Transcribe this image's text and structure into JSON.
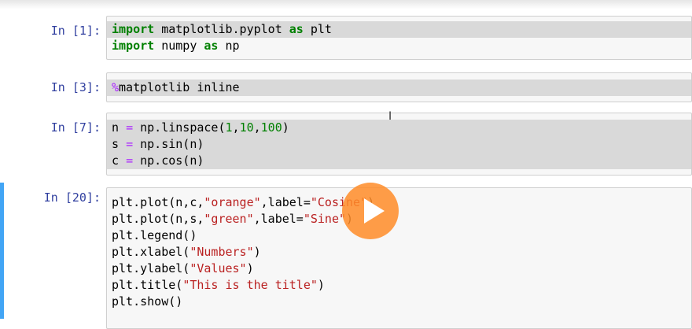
{
  "cells": [
    {
      "prompt": "In [1]:",
      "lines": [
        [
          {
            "t": "import",
            "c": "kw"
          },
          {
            "t": " matplotlib.pyplot ",
            "c": ""
          },
          {
            "t": "as",
            "c": "kw"
          },
          {
            "t": " plt",
            "c": ""
          }
        ],
        [
          {
            "t": "import",
            "c": "kw"
          },
          {
            "t": " numpy ",
            "c": ""
          },
          {
            "t": "as",
            "c": "kw"
          },
          {
            "t": " np",
            "c": ""
          }
        ]
      ]
    },
    {
      "prompt": "In [3]:",
      "lines": [
        [
          {
            "t": "%",
            "c": "magic"
          },
          {
            "t": "matplotlib inline",
            "c": ""
          }
        ]
      ]
    },
    {
      "prompt": "In [7]:",
      "lines": [
        [
          {
            "t": "n ",
            "c": ""
          },
          {
            "t": "=",
            "c": "eq"
          },
          {
            "t": " np.linspace(",
            "c": ""
          },
          {
            "t": "1",
            "c": "num"
          },
          {
            "t": ",",
            "c": ""
          },
          {
            "t": "10",
            "c": "num"
          },
          {
            "t": ",",
            "c": ""
          },
          {
            "t": "100",
            "c": "num"
          },
          {
            "t": ")",
            "c": ""
          }
        ],
        [
          {
            "t": "s ",
            "c": ""
          },
          {
            "t": "=",
            "c": "eq"
          },
          {
            "t": " np.sin(n)",
            "c": ""
          }
        ],
        [
          {
            "t": "c ",
            "c": ""
          },
          {
            "t": "=",
            "c": "eq"
          },
          {
            "t": " np.cos(n)",
            "c": ""
          }
        ]
      ]
    },
    {
      "prompt": "In [20]:",
      "lines": [
        [
          {
            "t": "plt.plot(n,c,",
            "c": ""
          },
          {
            "t": "\"orange\"",
            "c": "str"
          },
          {
            "t": ",label=",
            "c": ""
          },
          {
            "t": "\"Cosine\"",
            "c": "str"
          },
          {
            "t": ")",
            "c": ""
          }
        ],
        [
          {
            "t": "plt.plot(n,s,",
            "c": ""
          },
          {
            "t": "\"green\"",
            "c": "str"
          },
          {
            "t": ",label=",
            "c": ""
          },
          {
            "t": "\"Sine\"",
            "c": "str"
          },
          {
            "t": ")",
            "c": ""
          }
        ],
        [
          {
            "t": "plt.legend()",
            "c": ""
          }
        ],
        [
          {
            "t": "plt.xlabel(",
            "c": ""
          },
          {
            "t": "\"Numbers\"",
            "c": "str"
          },
          {
            "t": ")",
            "c": ""
          }
        ],
        [
          {
            "t": "plt.ylabel(",
            "c": ""
          },
          {
            "t": "\"Values\"",
            "c": "str"
          },
          {
            "t": ")",
            "c": ""
          }
        ],
        [
          {
            "t": "plt.title(",
            "c": ""
          },
          {
            "t": "\"This is the title\"",
            "c": "str"
          },
          {
            "t": ")",
            "c": ""
          }
        ],
        [
          {
            "t": "plt.show()",
            "c": ""
          }
        ]
      ]
    }
  ],
  "cursor_glyph": "I",
  "icons": {
    "play": "play-icon",
    "cursor": "text-cursor-icon"
  },
  "colors": {
    "selected_bar": "#42a5f5",
    "play_button": "#ff8c28",
    "prompt": "#303f9f"
  }
}
